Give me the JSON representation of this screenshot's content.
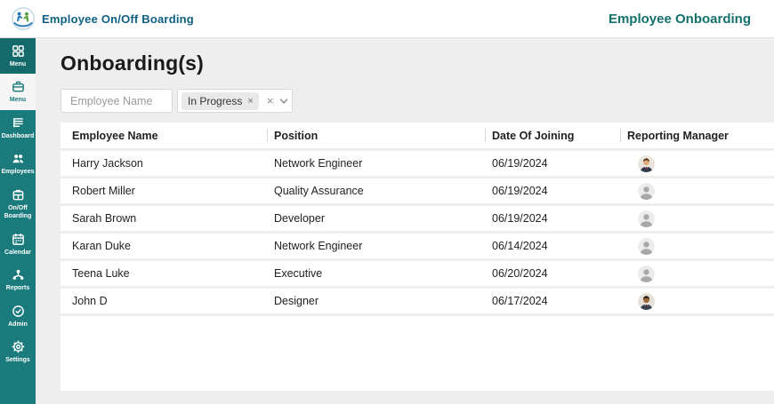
{
  "header": {
    "brand": "Employee On/Off Boarding",
    "page_title": "Employee Onboarding",
    "brand_color": "#0d5f82",
    "page_title_color": "#13706b"
  },
  "sidebar": {
    "bg_color": "#1a7a7c",
    "items": [
      {
        "label": "Menu",
        "icon": "grid-icon",
        "state": "dark"
      },
      {
        "label": "Menu",
        "icon": "briefcase-icon",
        "state": "active"
      },
      {
        "label": "Dashboard",
        "icon": "list-icon",
        "state": "normal"
      },
      {
        "label": "Employees",
        "icon": "people-icon",
        "state": "normal"
      },
      {
        "label": "On/Off Boarding",
        "icon": "boarding-icon",
        "state": "normal"
      },
      {
        "label": "Calendar",
        "icon": "calendar-icon",
        "state": "normal"
      },
      {
        "label": "Reports",
        "icon": "org-chart-icon",
        "state": "normal"
      },
      {
        "label": "Admin",
        "icon": "clock-icon",
        "state": "normal"
      },
      {
        "label": "Settings",
        "icon": "gear-icon",
        "state": "normal"
      }
    ]
  },
  "main": {
    "title": "Onboarding(s)",
    "filters": {
      "name_placeholder": "Employee Name",
      "status_chip": "In Progress",
      "chip_remove_glyph": "×",
      "clear_glyph": "×"
    },
    "table": {
      "columns": [
        "Employee Name",
        "Position",
        "Date Of Joining",
        "Reporting Manager"
      ],
      "rows": [
        {
          "name": "Harry Jackson",
          "position": "Network Engineer",
          "date": "06/19/2024",
          "avatar": "man-light"
        },
        {
          "name": "Robert Miller",
          "position": "Quality Assurance",
          "date": "06/19/2024",
          "avatar": "generic"
        },
        {
          "name": "Sarah Brown",
          "position": "Developer",
          "date": "06/19/2024",
          "avatar": "generic"
        },
        {
          "name": "Karan Duke",
          "position": "Network Engineer",
          "date": "06/14/2024",
          "avatar": "generic"
        },
        {
          "name": "Teena Luke",
          "position": "Executive",
          "date": "06/20/2024",
          "avatar": "generic"
        },
        {
          "name": "John D",
          "position": "Designer",
          "date": "06/17/2024",
          "avatar": "man-dark"
        }
      ]
    }
  }
}
